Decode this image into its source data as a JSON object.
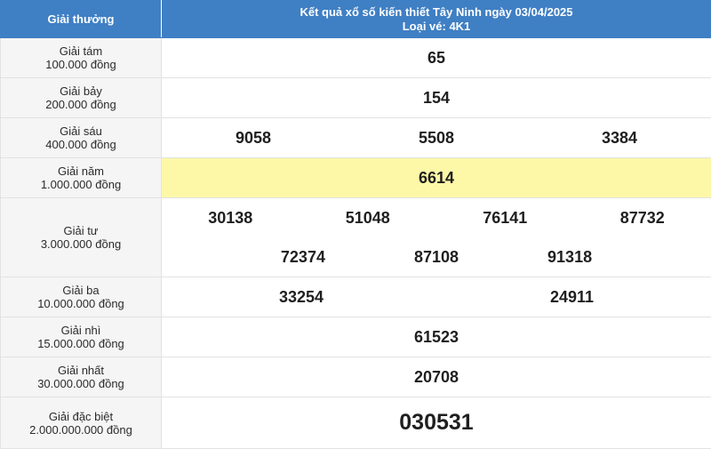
{
  "header": {
    "col_prize": "Giải thưởng",
    "title": "Kết quả xổ số kiến thiết Tây Ninh ngày 03/04/2025",
    "ticket_type": "Loại vé: 4K1"
  },
  "prizes": [
    {
      "name": "Giải tám",
      "amount": "100.000 đồng",
      "numbers": [
        "65"
      ]
    },
    {
      "name": "Giải bảy",
      "amount": "200.000 đồng",
      "numbers": [
        "154"
      ]
    },
    {
      "name": "Giải sáu",
      "amount": "400.000 đồng",
      "numbers": [
        "9058",
        "5508",
        "3384"
      ]
    },
    {
      "name": "Giải năm",
      "amount": "1.000.000 đồng",
      "numbers": [
        "6614"
      ]
    },
    {
      "name": "Giải tư",
      "amount": "3.000.000 đồng",
      "numbers": [
        "30138",
        "51048",
        "76141",
        "87732",
        "72374",
        "87108",
        "91318"
      ]
    },
    {
      "name": "Giải ba",
      "amount": "10.000.000 đồng",
      "numbers": [
        "33254",
        "24911"
      ]
    },
    {
      "name": "Giải nhì",
      "amount": "15.000.000 đồng",
      "numbers": [
        "61523"
      ]
    },
    {
      "name": "Giải nhất",
      "amount": "30.000.000 đồng",
      "numbers": [
        "20708"
      ]
    },
    {
      "name": "Giải đặc biệt",
      "amount": "2.000.000.000 đồng",
      "numbers": [
        "030531"
      ]
    }
  ],
  "colors": {
    "header_bg": "#3f7fc4",
    "highlight_bg": "#fdf8a8",
    "label_bg": "#f5f5f5"
  }
}
